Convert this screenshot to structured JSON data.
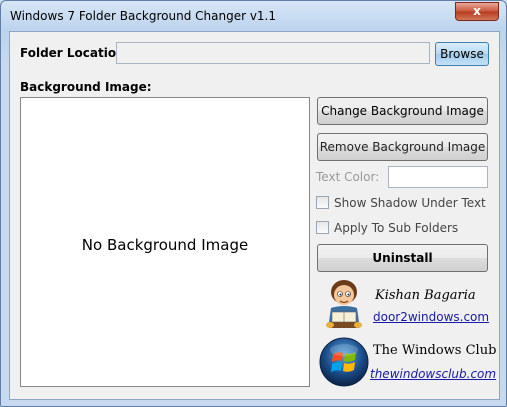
{
  "window": {
    "title": "Windows 7 Folder Background Changer v1.1",
    "close_glyph": "x"
  },
  "folder": {
    "label": "Folder Location:",
    "value": "",
    "browse_label": "Browse"
  },
  "background": {
    "label": "Background Image:",
    "preview_text": "No Background Image"
  },
  "actions": {
    "change_label": "Change Background Image",
    "remove_label": "Remove Background Image",
    "uninstall_label": "Uninstall"
  },
  "text_color": {
    "label": "Text Color:",
    "value": ""
  },
  "options": {
    "shadow": {
      "label": "Show Shadow Under Text",
      "checked": false
    },
    "subfolders": {
      "label": "Apply To Sub Folders",
      "checked": false
    }
  },
  "credits": {
    "author": {
      "name": "Kishan Bagaria",
      "link": "door2windows.com",
      "icon": "cartoon-reader-avatar"
    },
    "club": {
      "name": "The Windows Club",
      "link": "thewindowsclub.com",
      "icon": "windows-logo"
    }
  },
  "colors": {
    "close_red": "#c8553c",
    "browse_blue": "#9fcbec",
    "link_blue": "#1a1aa6"
  }
}
